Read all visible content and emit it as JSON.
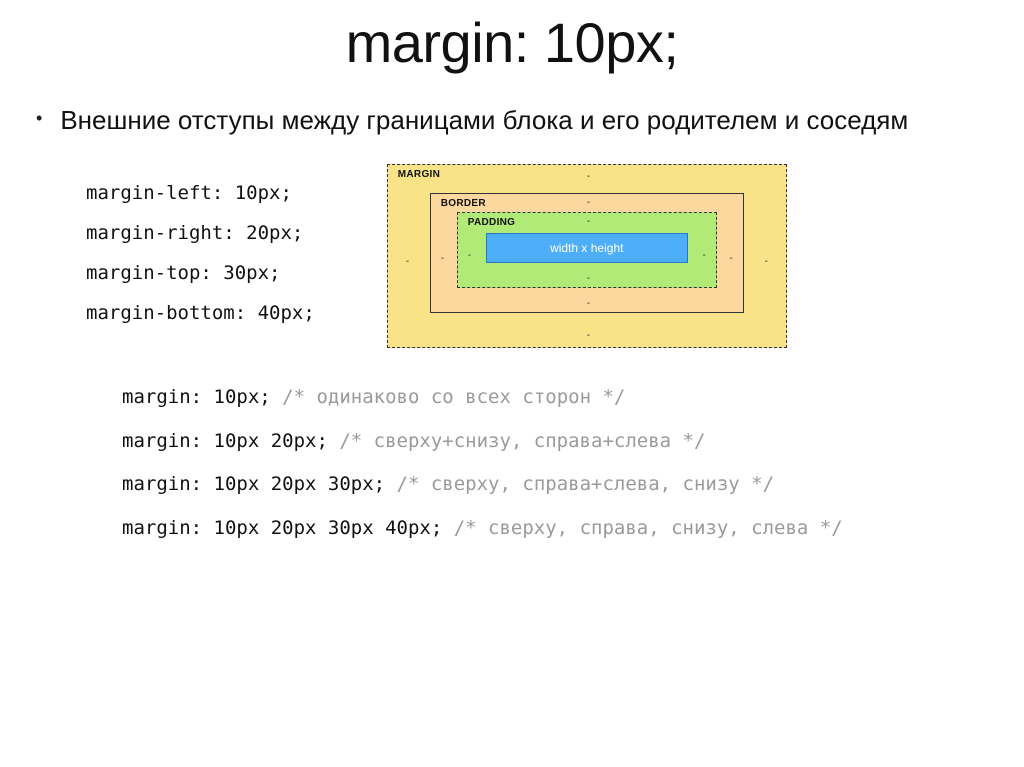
{
  "title": "margin: 10px;",
  "bullet_text": "Внешние отступы между границами блока и его родителем и соседям",
  "code_lines": {
    "l1": "margin-left: 10px;",
    "l2": "margin-right: 20px;",
    "l3": "margin-top: 30px;",
    "l4": "margin-bottom: 40px;"
  },
  "box_model": {
    "margin_label": "MARGIN",
    "border_label": "BORDER",
    "padding_label": "PADDING",
    "content_label": "width x height"
  },
  "shorthand": [
    {
      "code": "margin: 10px; ",
      "comment": "/* одинаково со всех сторон */"
    },
    {
      "code": "margin: 10px 20px; ",
      "comment": "/* сверху+снизу, справа+слева */"
    },
    {
      "code": "margin: 10px 20px 30px; ",
      "comment": "/* сверху, справа+слева, снизу */"
    },
    {
      "code": "margin: 10px 20px 30px 40px; ",
      "comment": "/* сверху, справа, снизу, слева */"
    }
  ]
}
